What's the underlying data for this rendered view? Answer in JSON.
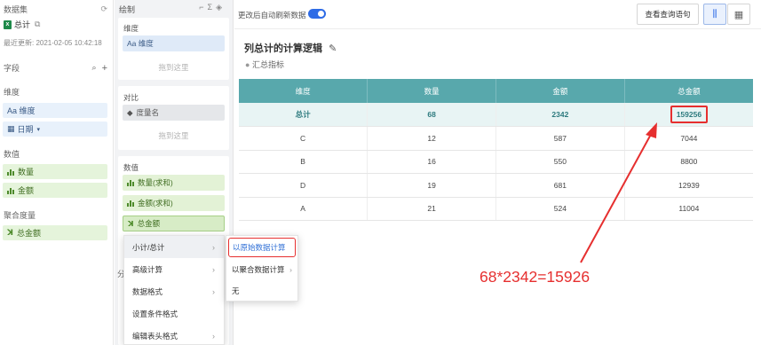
{
  "dataset": {
    "header": "数据集",
    "file_name": "总计",
    "last_updated": "最近更新: 2021-02-05 10:42:18",
    "fields_label": "字段",
    "dimension_section": "维度",
    "dimensions": [
      "Aa 维度",
      "日期"
    ],
    "measure_section": "数值",
    "measures": [
      "数量",
      "金额"
    ],
    "agg_section": "聚合度量",
    "agg_measures": [
      "总金额"
    ]
  },
  "config": {
    "header": "绘制",
    "dimension_card": {
      "title": "维度",
      "field": "Aa 维度",
      "hint": "拖到这里"
    },
    "compare_card": {
      "title": "对比",
      "field": "度量名",
      "hint": "拖到这里"
    },
    "value_card": {
      "title": "数值",
      "fields": [
        "数量(求和)",
        "金额(求和)",
        "总金额"
      ]
    },
    "hidden_label": "分"
  },
  "context_menu": {
    "items": [
      "小计/总计",
      "高级计算",
      "数据格式",
      "设置条件格式",
      "编辑表头格式"
    ],
    "submenu": [
      "以原始数据计算",
      "以聚合数据计算",
      "无"
    ]
  },
  "preview": {
    "auto_refresh_label": "更改后自动刷新数据",
    "view_sql_label": "查看查询语句",
    "title": "列总计的计算逻辑",
    "subtitle": "汇总指标",
    "columns": [
      "维度",
      "数量",
      "金额",
      "总金额"
    ],
    "total_row": [
      "总计",
      "68",
      "2342",
      "159256"
    ],
    "rows": [
      [
        "C",
        "12",
        "587",
        "7044"
      ],
      [
        "B",
        "16",
        "550",
        "8800"
      ],
      [
        "D",
        "19",
        "681",
        "12939"
      ],
      [
        "A",
        "21",
        "524",
        "11004"
      ]
    ]
  },
  "annotation": "68*2342=15926",
  "colors": {
    "header_teal": "#58a8ac",
    "highlight_red": "#e62f2f",
    "toggle_blue": "#2e6be6",
    "measure_green": "#e5f4db"
  },
  "icons": [
    "excel-icon",
    "edit-icon",
    "search-icon",
    "plus-icon",
    "calendar-icon",
    "bar-measure-icon",
    "agg-measure-icon",
    "tag-icon",
    "chart-view-icon",
    "table-view-icon"
  ]
}
